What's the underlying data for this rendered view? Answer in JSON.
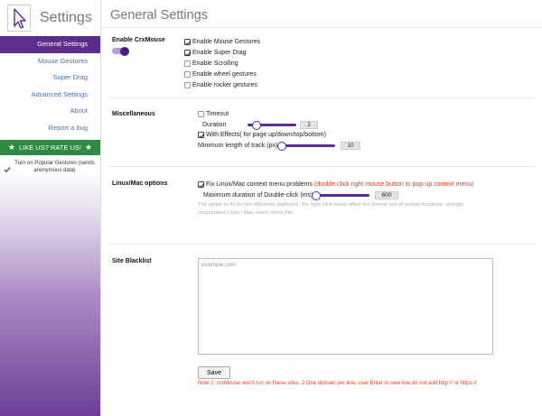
{
  "sidebar": {
    "title": "Settings",
    "items": [
      {
        "label": "General Settings",
        "active": true
      },
      {
        "label": "Mouse Gestures",
        "active": false
      },
      {
        "label": "Super Drag",
        "active": false
      },
      {
        "label": "Advanced Settings",
        "active": false
      },
      {
        "label": "About",
        "active": false
      },
      {
        "label": "Report a bug",
        "active": false
      }
    ],
    "rate_label": "LIKE US? RATE US!",
    "popular_label": "Turn on Popular Gestures (sends anonymous data)",
    "popular_checked": true
  },
  "main": {
    "title": "General Settings",
    "enable": {
      "label": "Enable CrxMouse",
      "toggle_on": true,
      "options": [
        {
          "label": "Enable Mouse Gestures",
          "checked": true
        },
        {
          "label": "Enable Super Drag",
          "checked": true
        },
        {
          "label": "Enable Scrolling",
          "checked": false
        },
        {
          "label": "Enable wheel gestures",
          "checked": false
        },
        {
          "label": "Enable rocker gestures",
          "checked": false
        }
      ]
    },
    "misc": {
      "label": "Miscellaneous",
      "timeout_label": "Timeout",
      "timeout_checked": false,
      "duration_label": "Duration",
      "duration_value": "2",
      "effects_label": "With Effects( for page up/down/top/bottom)",
      "effects_checked": true,
      "track_label": "Minimum length of track (px)",
      "track_value": "10"
    },
    "linux": {
      "label": "Linux/Mac options",
      "fix_label": "Fix Linux/Mac context menu problems",
      "fix_note": "(double click right mouse button to pop-up context menu)",
      "fix_checked": true,
      "dbl_label": "Maximum duration of Double-click (ms)",
      "dbl_value": "600",
      "hint": "The option to fix on non-Windows platforms, the right-click menu affect the normal use of certain functions, strongly recommend Linux / Mac users check this."
    },
    "blacklist": {
      "label": "Site Blacklist",
      "placeholder": "example.com",
      "save_label": "Save",
      "note": "Note:1. crxMouse won't run on these sites. 2.One domain per line, user Enter to new line do not add http:// or https://"
    }
  }
}
